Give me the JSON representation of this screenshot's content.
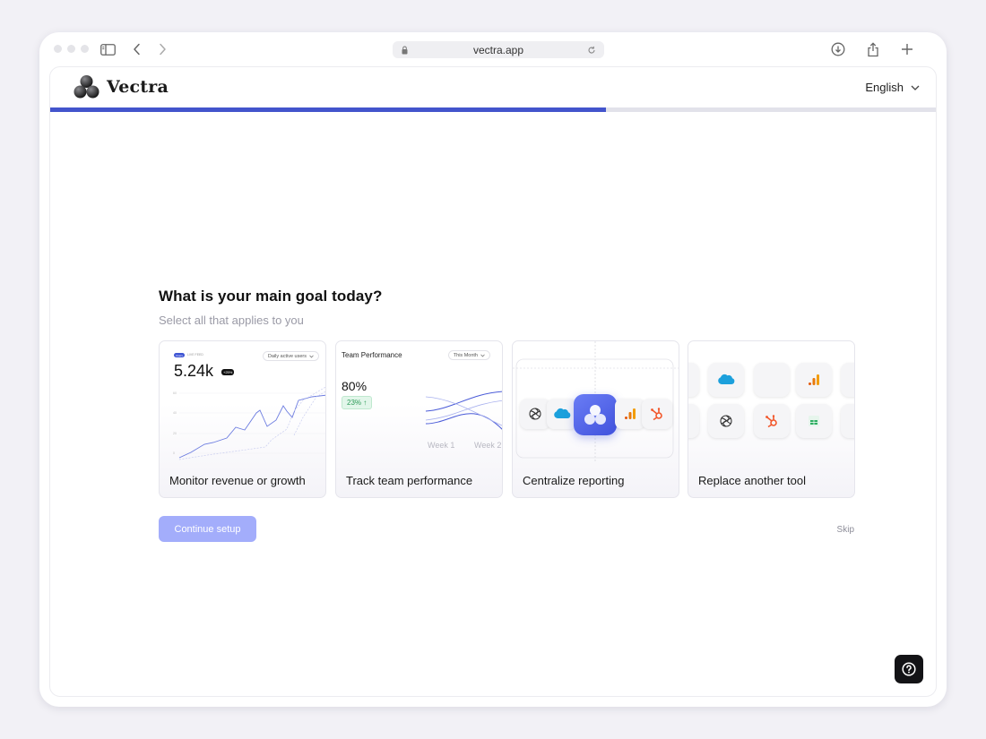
{
  "browser": {
    "url": "vectra.app"
  },
  "header": {
    "brand": "Vectra",
    "language": "English"
  },
  "progress": {
    "fraction": 0.628
  },
  "question": {
    "title": "What is your main goal today?",
    "subtitle": "Select all that applies to you"
  },
  "cards": [
    {
      "label": "Monitor revenue or growth",
      "preview": {
        "badge": "Users",
        "badge_text": "LIVE FEED",
        "dropdown": "Daily active users",
        "value": "5.24k",
        "change": "+25%"
      }
    },
    {
      "label": "Track team performance",
      "preview": {
        "title": "Team Performance",
        "dropdown": "This Month",
        "value": "80%",
        "change": "23% ↑",
        "week1": "Week 1",
        "week2": "Week 2"
      }
    },
    {
      "label": "Centralize reporting"
    },
    {
      "label": "Replace another tool"
    }
  ],
  "actions": {
    "continue": "Continue setup",
    "skip": "Skip"
  },
  "colors": {
    "accent": "#4354cc",
    "button_disabled": "#a3adfb",
    "track": "#e2e2ea",
    "help_bg": "#131316"
  },
  "icons": [
    "sidebar-icon",
    "back-icon",
    "forward-icon",
    "lock-icon",
    "reload-icon",
    "download-icon",
    "share-icon",
    "new-tab-icon",
    "chevron-down-icon",
    "help-icon",
    "openai-icon",
    "salesforce-icon",
    "analytics-icon",
    "hubspot-icon",
    "sheets-icon"
  ]
}
